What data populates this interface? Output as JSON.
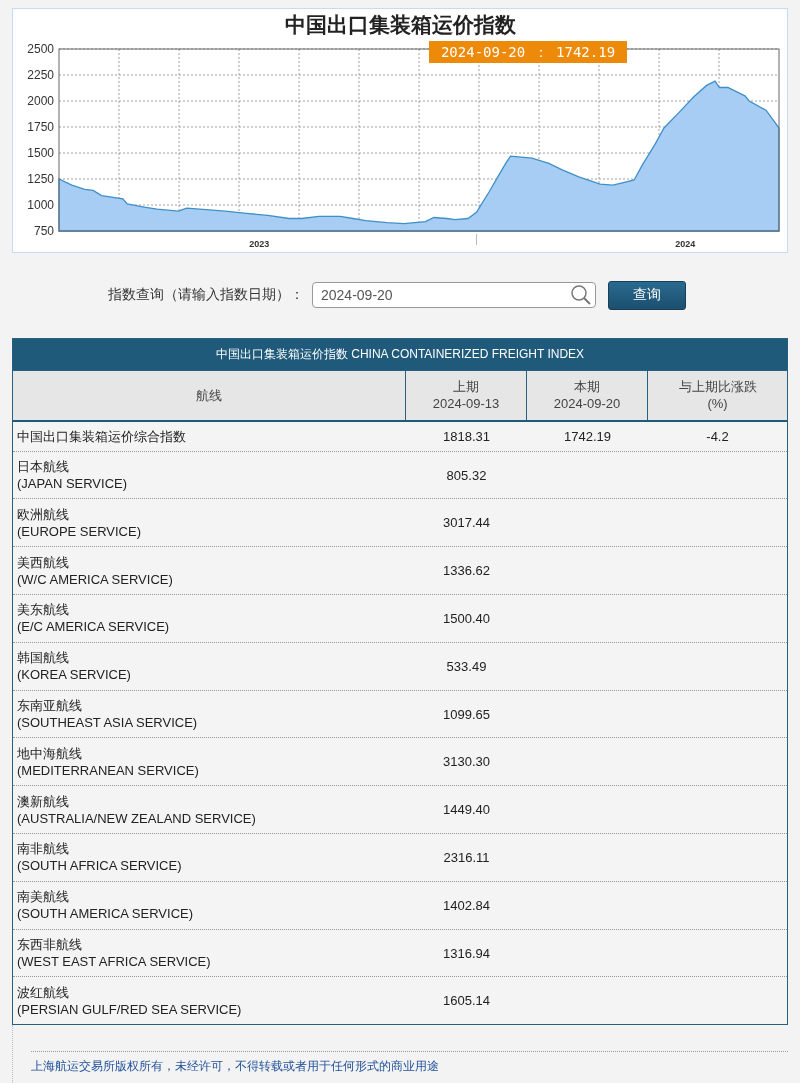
{
  "chart": {
    "title": "中国出口集装箱运价指数",
    "tooltip": "2024-09-20 ： 1742.19",
    "chart_data": {
      "type": "area",
      "grid": true,
      "xlim": [
        2022.53,
        2024.22
      ],
      "ylim": [
        750,
        2500
      ],
      "yticks": [
        750,
        1000,
        1250,
        1500,
        1750,
        2000,
        2250,
        2500
      ],
      "xticks": [
        2023,
        2024
      ],
      "x": [
        2022.53,
        2022.56,
        2022.59,
        2022.61,
        2022.63,
        2022.68,
        2022.69,
        2022.73,
        2022.76,
        2022.81,
        2022.83,
        2022.86,
        2022.92,
        2022.97,
        2023.02,
        2023.07,
        2023.1,
        2023.14,
        2023.19,
        2023.22,
        2023.25,
        2023.3,
        2023.34,
        2023.39,
        2023.41,
        2023.44,
        2023.46,
        2023.49,
        2023.51,
        2023.54,
        2023.56,
        2023.58,
        2023.59,
        2023.64,
        2023.68,
        2023.71,
        2023.75,
        2023.8,
        2023.83,
        2023.85,
        2023.88,
        2023.9,
        2023.93,
        2023.95,
        2023.99,
        2024.02,
        2024.05,
        2024.07,
        2024.08,
        2024.1,
        2024.14,
        2024.15,
        2024.19,
        2024.22
      ],
      "series": [
        {
          "color": "#a8cdf5",
          "values": [
            1250,
            1190,
            1150,
            1140,
            1090,
            1060,
            1010,
            980,
            960,
            940,
            970,
            960,
            940,
            920,
            900,
            870,
            870,
            890,
            890,
            870,
            850,
            830,
            820,
            840,
            880,
            870,
            860,
            870,
            930,
            1130,
            1270,
            1410,
            1470,
            1450,
            1400,
            1340,
            1270,
            1200,
            1190,
            1210,
            1240,
            1390,
            1590,
            1740,
            1910,
            2040,
            2150,
            2190,
            2130,
            2130,
            2050,
            2000,
            1910,
            1740
          ]
        }
      ]
    }
  },
  "query": {
    "label": "指数查询（请输入指数日期）：",
    "value": "2024-09-20",
    "button": "查询"
  },
  "table": {
    "title": "中国出口集装箱运价指数 CHINA CONTAINERIZED FREIGHT INDEX",
    "columns": [
      {
        "lines": [
          "航线"
        ]
      },
      {
        "lines": [
          "上期",
          "2024-09-13"
        ]
      },
      {
        "lines": [
          "本期",
          "2024-09-20"
        ]
      },
      {
        "lines": [
          "与上期比涨跌",
          "(%)"
        ]
      }
    ],
    "rows": [
      {
        "route": "中国出口集装箱运价综合指数",
        "previous": "1818.31",
        "current": "1742.19",
        "change": "-4.2"
      },
      {
        "route": "日本航线",
        "route_en": "(JAPAN SERVICE)",
        "previous": "805.32"
      },
      {
        "route": "欧洲航线",
        "route_en": "(EUROPE SERVICE)",
        "previous": "3017.44"
      },
      {
        "route": "美西航线",
        "route_en": "(W/C AMERICA SERVICE)",
        "previous": "1336.62"
      },
      {
        "route": "美东航线",
        "route_en": "(E/C AMERICA SERVICE)",
        "previous": "1500.40"
      },
      {
        "route": "韩国航线",
        "route_en": "(KOREA SERVICE)",
        "previous": "533.49"
      },
      {
        "route": "东南亚航线",
        "route_en": "(SOUTHEAST ASIA SERVICE)",
        "previous": "1099.65"
      },
      {
        "route": "地中海航线",
        "route_en": "(MEDITERRANEAN SERVICE)",
        "previous": "3130.30"
      },
      {
        "route": "澳新航线",
        "route_en": "(AUSTRALIA/NEW ZEALAND SERVICE)",
        "previous": "1449.40"
      },
      {
        "route": "南非航线",
        "route_en": "(SOUTH AFRICA SERVICE)",
        "previous": "2316.11"
      },
      {
        "route": "南美航线",
        "route_en": "(SOUTH AMERICA SERVICE)",
        "previous": "1402.84"
      },
      {
        "route": "东西非航线",
        "route_en": "(WEST EAST AFRICA SERVICE)",
        "previous": "1316.94"
      },
      {
        "route": "波红航线",
        "route_en": "(PERSIAN GULF/RED SEA SERVICE)",
        "previous": "1605.14"
      }
    ]
  },
  "footer": {
    "text": "上海航运交易所版权所有，未经许可，不得转载或者用于任何形式的商业用途"
  }
}
